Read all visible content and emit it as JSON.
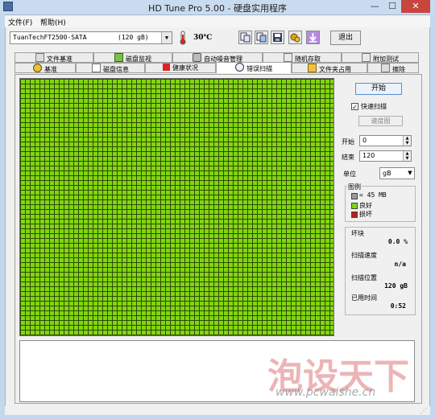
{
  "window": {
    "title": "HD Tune Pro 5.00 - 硬盘实用程序",
    "minimize": "—",
    "maximize": "☐",
    "close": "✕"
  },
  "menu": {
    "file": "文件(F)",
    "help": "帮助(H)"
  },
  "toolbar": {
    "drive": "TuanTechFT2500-SATA        (120 gB)",
    "temperature": "30℃",
    "exit": "退出"
  },
  "tabs_row1": [
    "文件基准",
    "磁盘监视",
    "自动噪音管理",
    "随机存取",
    "附加测试"
  ],
  "tabs_row2": [
    "基准",
    "磁盘信息",
    "健康状况",
    "错误扫描",
    "文件夹占用",
    "擦除"
  ],
  "active_tab": "错误扫描",
  "controls": {
    "start_button": "开始",
    "quick_scan_label": "快速扫描",
    "quick_scan_checked": "✓",
    "speed_map_button": "速度图",
    "start_label": "开始",
    "start_value": "0",
    "end_label": "结束",
    "end_value": "120",
    "unit_label": "单位",
    "unit_value": "gB"
  },
  "legend": {
    "title": "图例",
    "block_size": "= 45 MB",
    "good": "良好",
    "bad": "损坏"
  },
  "stats": {
    "damaged_label": "坏块",
    "damaged_value": "0.0 %",
    "speed_label": "扫描速度",
    "speed_value": "n/a",
    "position_label": "扫描位置",
    "position_value": "120 gB",
    "elapsed_label": "已用时间",
    "elapsed_value": "0:52"
  },
  "watermark": {
    "text": "泡设天下",
    "url": "www.pcwaishe.cn"
  },
  "colors": {
    "good_block": "#82d60e",
    "bad_block": "#b22222",
    "empty_block": "#9a9a9a"
  }
}
